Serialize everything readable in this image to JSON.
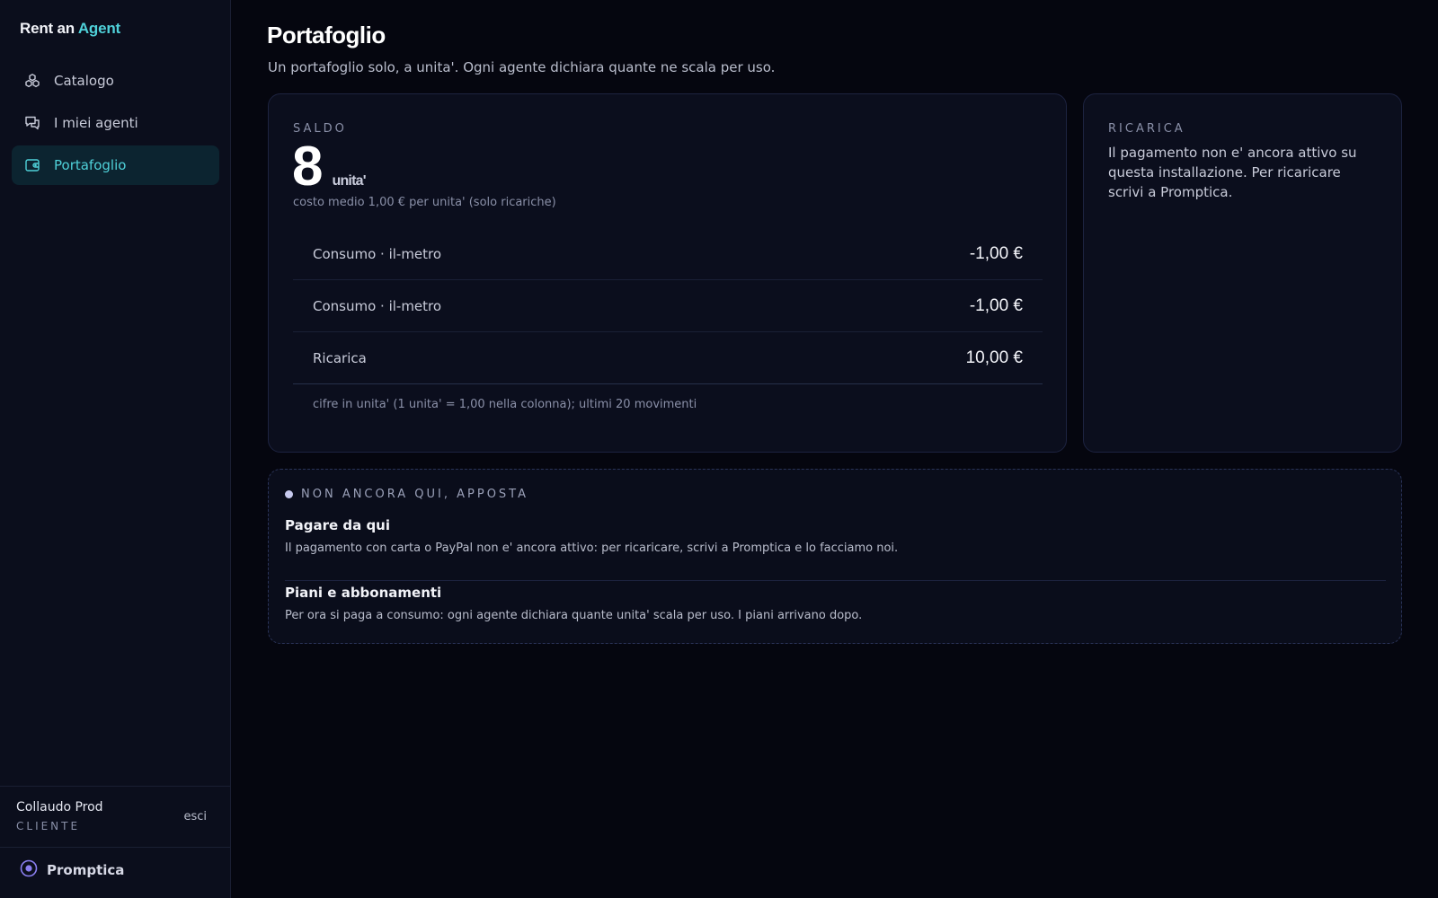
{
  "brand": {
    "prefix": "Rent an",
    "accent": "Agent"
  },
  "nav": {
    "items": [
      {
        "label": "Catalogo",
        "icon": "cubes-icon"
      },
      {
        "label": "I miei agenti",
        "icon": "chat-bubbles-icon"
      },
      {
        "label": "Portafoglio",
        "icon": "wallet-icon",
        "active": true
      }
    ]
  },
  "user": {
    "name": "Collaudo Prod",
    "role": "CLIENTE",
    "logout": "esci"
  },
  "footer": {
    "brand": "Promptica",
    "icon": "target-icon"
  },
  "page": {
    "title": "Portafoglio",
    "subtitle": "Un portafoglio solo, a unita'. Ogni agente dichiara quante ne scala per uso."
  },
  "saldo": {
    "label": "SALDO",
    "value": "8",
    "unit": "unita'",
    "avg_cost": "costo medio 1,00 € per unita' (solo ricariche)",
    "movements": [
      {
        "label": "Consumo · il-metro",
        "amount": "-1,00 €"
      },
      {
        "label": "Consumo · il-metro",
        "amount": "-1,00 €"
      },
      {
        "label": "Ricarica",
        "amount": "10,00 €"
      }
    ],
    "note": "cifre in unita' (1 unita' = 1,00 nella colonna); ultimi 20 movimenti"
  },
  "ricarica": {
    "label": "RICARICA",
    "text": "Il pagamento non e' ancora attivo su questa installazione. Per ricaricare scrivi a Promptica."
  },
  "soon": {
    "title": "NON ANCORA QUI, APPOSTA",
    "items": [
      {
        "title": "Pagare da qui",
        "text": "Il pagamento con carta o PayPal non e' ancora attivo: per ricaricare, scrivi a Promptica e lo facciamo noi."
      },
      {
        "title": "Piani e abbonamenti",
        "text": "Per ora si paga a consumo: ogni agente dichiara quante unita' scala per uso. I piani arrivano dopo."
      }
    ]
  },
  "colors": {
    "accent": "#4fd1d9",
    "background": "#05060f",
    "sidebar": "#0b0e1c",
    "card": "#0b0e1d"
  }
}
